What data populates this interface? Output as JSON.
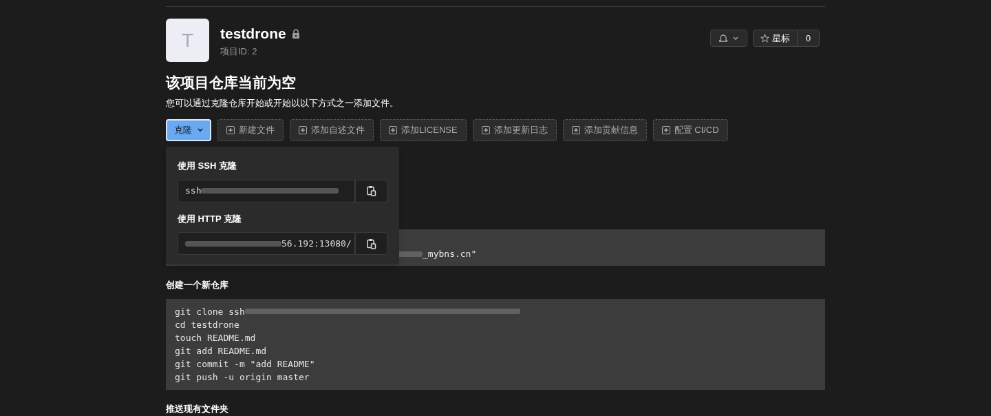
{
  "project": {
    "avatar_letter": "T",
    "name": "testdrone",
    "private": true,
    "id_label": "项目ID: 2"
  },
  "actions": {
    "star_label": "星标",
    "star_count": "0"
  },
  "empty": {
    "title": "该项目仓库当前为空",
    "subtitle": "您可以通过克隆仓库开始或开始以以下方式之一添加文件。"
  },
  "toolbar": [
    {
      "kind": "dropdown",
      "label": "克隆",
      "expanded": true
    },
    {
      "kind": "add",
      "label": "新建文件"
    },
    {
      "kind": "add",
      "label": "添加自述文件"
    },
    {
      "kind": "add",
      "label": "添加LICENSE"
    },
    {
      "kind": "add",
      "label": "添加更新日志"
    },
    {
      "kind": "add",
      "label": "添加贡献信息"
    },
    {
      "kind": "add",
      "label": "配置 CI/CD"
    }
  ],
  "clone_menu": [
    {
      "label": "使用 SSH 克隆",
      "value_start": "ssh"
    },
    {
      "label": "使用 HTTP 克隆",
      "value_end": "56.192:13080/"
    }
  ],
  "sections": [
    {
      "lines": [
        "_mybns.cn\""
      ]
    },
    {
      "title": "创建一个新仓库",
      "lines": [
        "git clone ssh",
        "cd testdrone",
        "touch README.md",
        "git add README.md",
        "git commit -m \"add README\"",
        "git push -u origin master"
      ]
    },
    {
      "title": "推送现有文件夹"
    }
  ]
}
